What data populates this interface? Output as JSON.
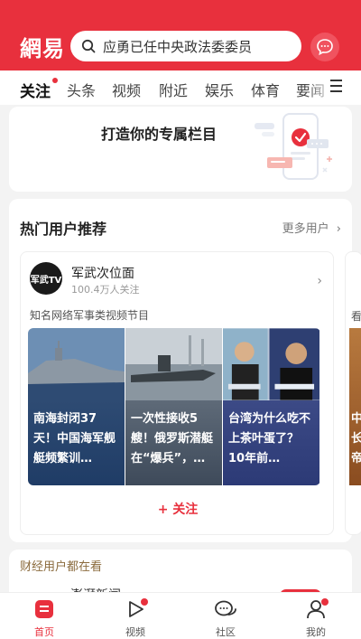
{
  "header": {
    "logo": "網易",
    "search_placeholder": "应勇已任中央政法委委员"
  },
  "tabs": [
    {
      "label": "关注",
      "active": true,
      "has_dot": true
    },
    {
      "label": "头条"
    },
    {
      "label": "视频"
    },
    {
      "label": "附近"
    },
    {
      "label": "娱乐"
    },
    {
      "label": "体育"
    },
    {
      "label": "要闻"
    }
  ],
  "banner": {
    "text": "打造你的专属栏目"
  },
  "recommend": {
    "title": "热门用户推荐",
    "more": "更多用户",
    "user": {
      "avatar_text": "军武TV",
      "name": "军武次位面",
      "followers": "100.4万人关注",
      "desc": "知名网络军事类视频节目",
      "videos": [
        {
          "caption": "南海封闭37天！中国海军舰艇频繁训…"
        },
        {
          "caption": "一次性接收5艘！俄罗斯潜艇在“爆兵”，…"
        },
        {
          "caption": "台湾为什么吃不上茶叶蛋了？10年前…"
        }
      ],
      "follow_label": "+ 关注"
    },
    "next_user": {
      "desc_peek": "看",
      "caption_peek": "中长帝"
    }
  },
  "finance": {
    "title": "财经用户都在看",
    "peek_name": "澎湃新闻"
  },
  "bottom_nav": [
    {
      "label": "首页",
      "icon": "home-icon",
      "active": true
    },
    {
      "label": "视频",
      "icon": "video-play-icon",
      "dot": true
    },
    {
      "label": "社区",
      "icon": "chat-bubbles-icon"
    },
    {
      "label": "我的",
      "icon": "user-icon",
      "dot": true
    }
  ],
  "colors": {
    "brand": "#e8303d",
    "finance_title": "#8a6a3c"
  }
}
